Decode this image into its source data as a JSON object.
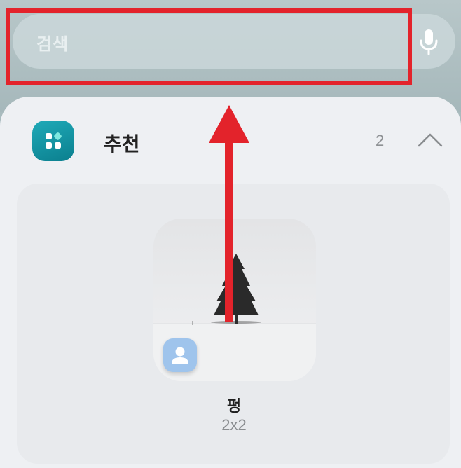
{
  "search": {
    "placeholder": "검색",
    "mic_icon": "mic-icon"
  },
  "section": {
    "icon": "widget-apps-icon",
    "title": "추천",
    "count": "2",
    "collapse_icon": "chevron-up-icon"
  },
  "widget": {
    "name": "펑",
    "size": "2x2",
    "preview_image": "lone-tree-in-snow",
    "badge_icon": "contact-icon"
  },
  "annotation": {
    "box_color": "#e3232b",
    "arrow_color": "#e3232b",
    "arrow_direction": "up"
  },
  "colors": {
    "accent": "#0b7f8e",
    "panel": "#eef0f3",
    "badge": "#9fc4ec"
  }
}
